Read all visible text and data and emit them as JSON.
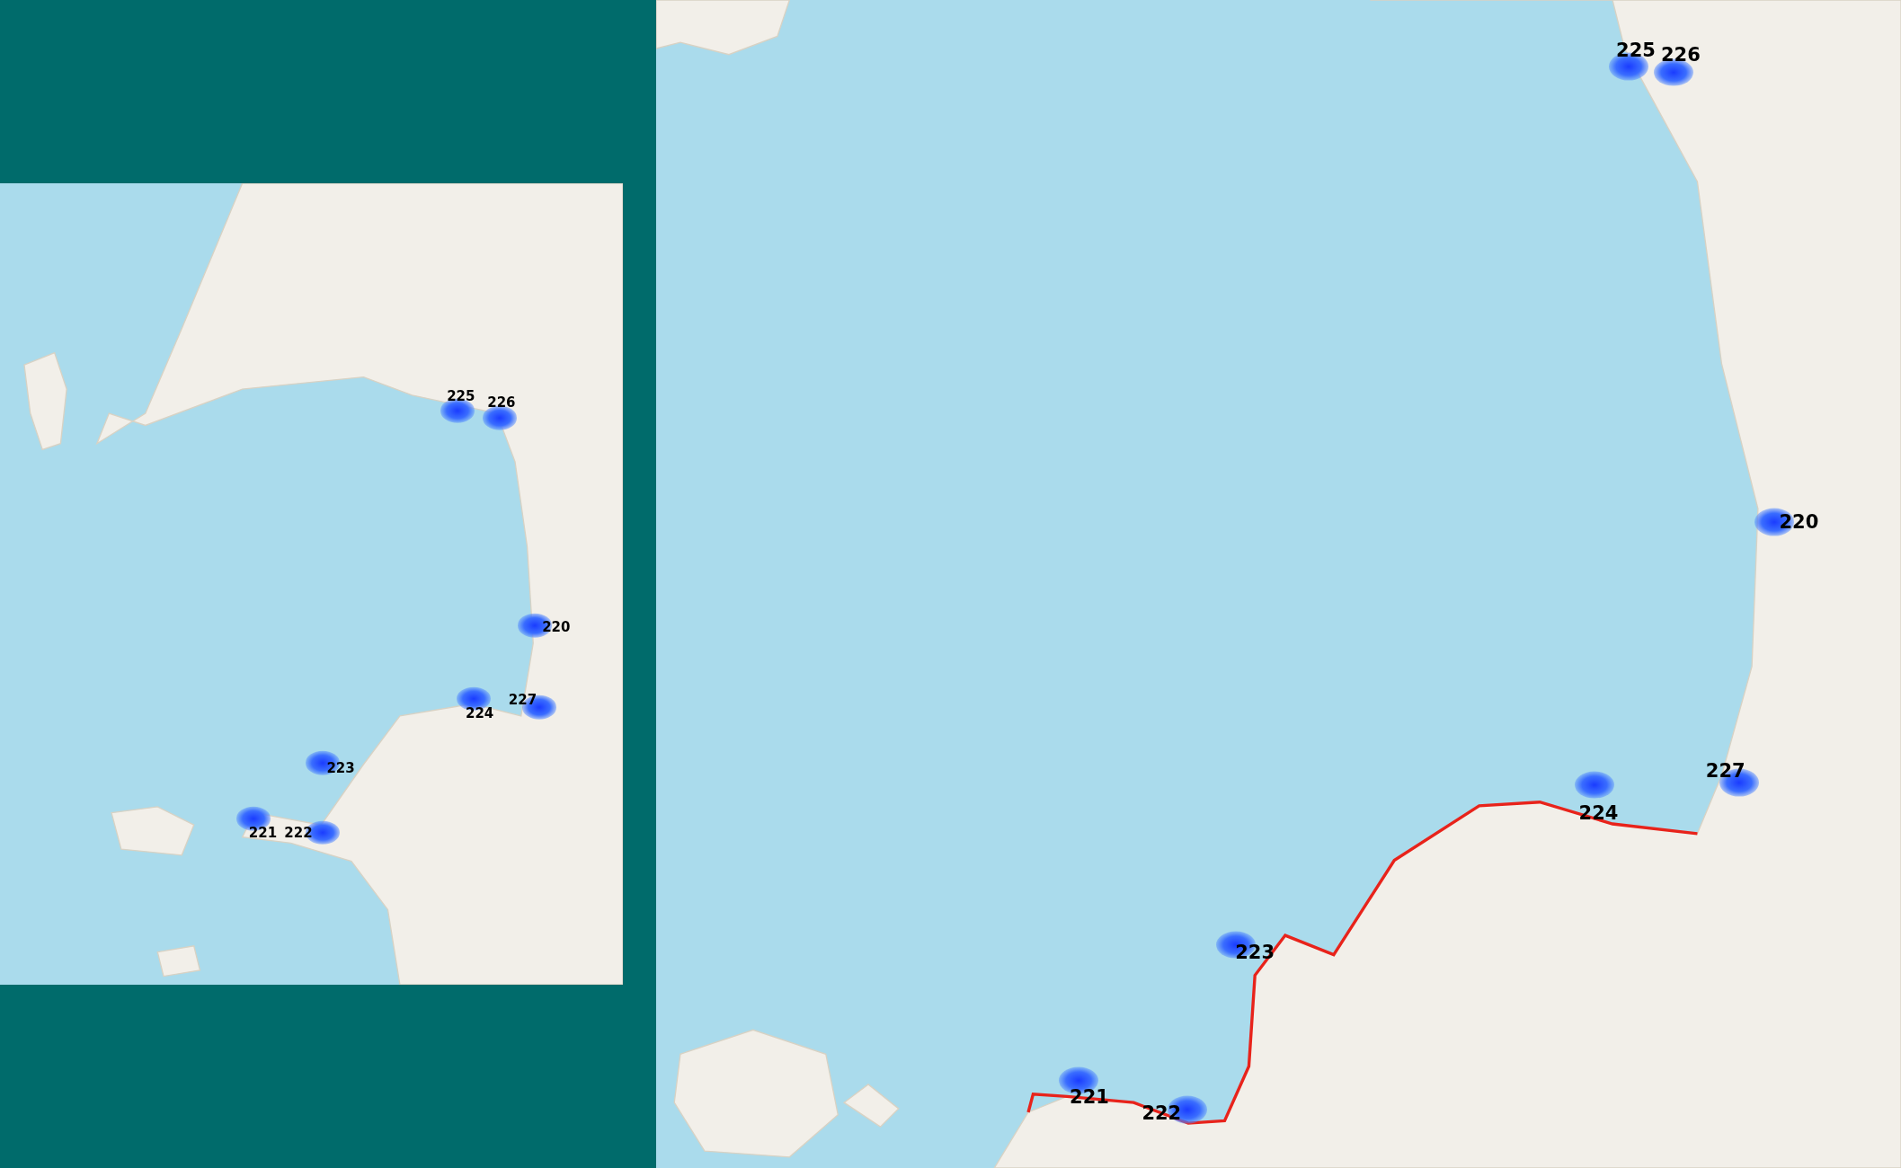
{
  "overview_map": {
    "markers": [
      {
        "label": "225"
      },
      {
        "label": "226"
      },
      {
        "label": "220"
      },
      {
        "label": "224"
      },
      {
        "label": "227"
      },
      {
        "label": "223"
      },
      {
        "label": "221"
      },
      {
        "label": "222"
      }
    ]
  },
  "detail_map": {
    "markers": [
      {
        "label": "225"
      },
      {
        "label": "226"
      },
      {
        "label": "220"
      },
      {
        "label": "227"
      },
      {
        "label": "224"
      },
      {
        "label": "223"
      },
      {
        "label": "221"
      },
      {
        "label": "222"
      }
    ]
  }
}
